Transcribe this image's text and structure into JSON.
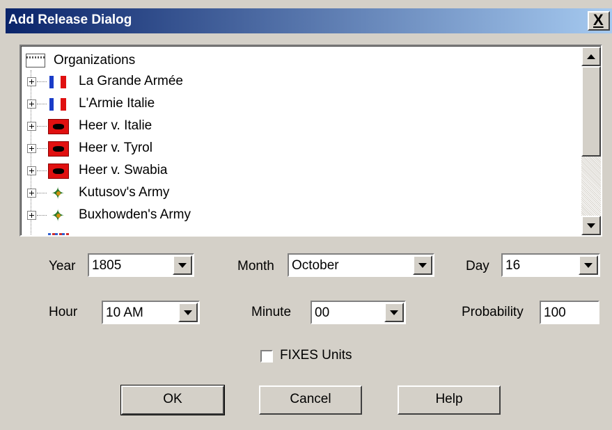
{
  "window": {
    "title": "Add Release Dialog",
    "close_label": "X"
  },
  "tree": {
    "root_label": "Organizations",
    "root_icon": "organizations-icon",
    "items": [
      {
        "label": "La Grande Armée",
        "flag": "france-flag-icon"
      },
      {
        "label": "L'Armie Italie",
        "flag": "france-flag-icon"
      },
      {
        "label": "Heer v. Italie",
        "flag": "austria-flag-icon"
      },
      {
        "label": "Heer v. Tyrol",
        "flag": "austria-flag-icon"
      },
      {
        "label": "Heer v. Swabia",
        "flag": "austria-flag-icon"
      },
      {
        "label": "Kutusov's Army",
        "flag": "russia-flag-icon"
      },
      {
        "label": "Buxhowden's Army",
        "flag": "russia-flag-icon"
      }
    ],
    "partial_item": {
      "label": "",
      "flag": "flag-icon"
    }
  },
  "fields": {
    "year_label": "Year",
    "year_value": "1805",
    "month_label": "Month",
    "month_value": "October",
    "day_label": "Day",
    "day_value": "16",
    "hour_label": "Hour",
    "hour_value": "10 AM",
    "minute_label": "Minute",
    "minute_value": "00",
    "probability_label": "Probability",
    "probability_value": "100"
  },
  "fixes": {
    "label": "FIXES Units",
    "checked": false
  },
  "buttons": {
    "ok": "OK",
    "cancel": "Cancel",
    "help": "Help"
  },
  "colors": {
    "dialog_bg": "#d4d0c8",
    "title_gradient_start": "#0a246a",
    "title_gradient_end": "#a6caf0"
  }
}
